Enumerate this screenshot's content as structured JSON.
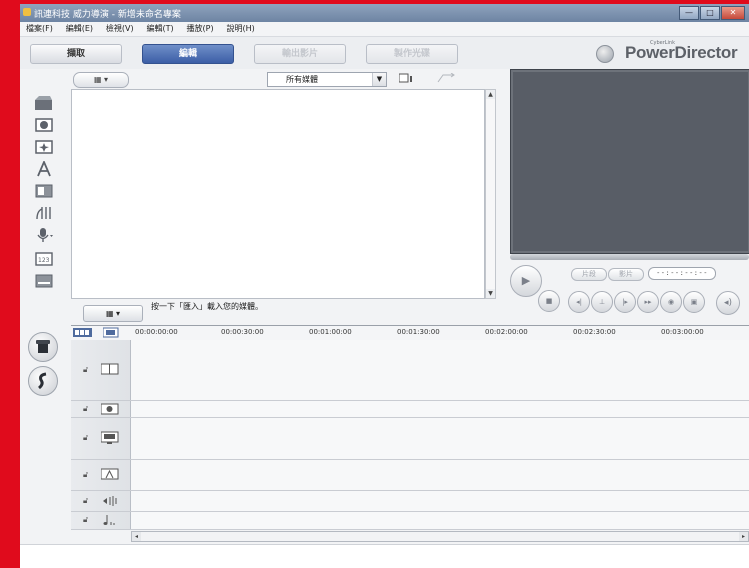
{
  "window": {
    "title": "訊連科技 威力導演 - 新增未命名專案",
    "minimize": "—",
    "maximize": "□",
    "close": "✕"
  },
  "menu": [
    "檔案(F)",
    "編輯(E)",
    "檢視(V)",
    "編輯(T)",
    "播放(P)",
    "說明(H)"
  ],
  "modes": {
    "capture": "擷取",
    "edit": "編輯",
    "produce": "輸出影片",
    "disc": "製作光碟"
  },
  "brand": {
    "name": "PowerDirector",
    "super": "CyberLink"
  },
  "library": {
    "view_button": "▦ ▾",
    "filter_value": "所有媒體",
    "filter_arrow": "▼",
    "import_button": "▦ ▾",
    "hint": "按一下「匯入」載入您的媒體。"
  },
  "preview": {
    "clip_label": "片段",
    "movie_label": "影片",
    "timecode": "--:--:--:--"
  },
  "timeline": {
    "ruler": [
      "00:00:00:00",
      "00:00:30:00",
      "00:01:00:00",
      "00:01:30:00",
      "00:02:00:00",
      "00:02:30:00",
      "00:03:00:00"
    ],
    "scroll_left": "◂",
    "scroll_right": "▸"
  },
  "icons": {
    "tools": [
      "media-room-icon",
      "effect-room-icon",
      "pip-room-icon",
      "title-room-icon",
      "transition-room-icon",
      "audio-mixing-icon",
      "voice-over-icon",
      "chapter-room-icon",
      "subtitle-room-icon"
    ],
    "tracks": [
      "video-track-icon",
      "effect-track-icon",
      "pip-track-icon",
      "title-track-icon",
      "voice-track-icon",
      "music-track-icon"
    ]
  },
  "colors": {
    "accent": "#3c5ea6",
    "preview_bg": "#585d66",
    "frame": "#e00b1c"
  }
}
